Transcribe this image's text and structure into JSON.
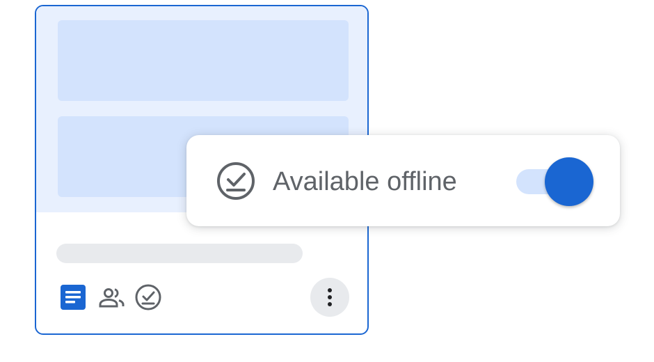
{
  "file_card": {
    "file_type_icon": "google-docs-icon",
    "shared_icon": "people-icon",
    "offline_status_icon": "offline-check-icon",
    "more_options_icon": "more-vert-icon"
  },
  "popup": {
    "icon": "offline-check-icon",
    "label": "Available offline",
    "toggle_state": "on"
  },
  "colors": {
    "accent": "#1a66d2",
    "preview_background": "#e8f0fe",
    "preview_block": "#d3e3fd",
    "placeholder_gray": "#e8eaed",
    "icon_gray": "#5f6368"
  }
}
